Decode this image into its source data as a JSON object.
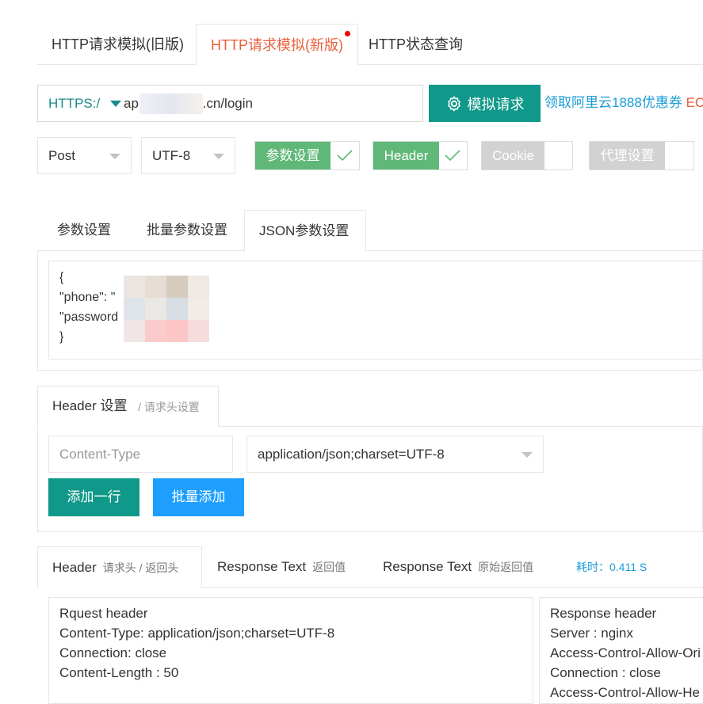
{
  "top_tabs": [
    {
      "label": "HTTP请求模拟(旧版)"
    },
    {
      "label": "HTTP请求模拟(新版)"
    },
    {
      "label": "HTTP状态查询"
    }
  ],
  "url_bar": {
    "protocol": "HTTPS:/",
    "url_prefix": "ap",
    "url_suffix": "..cn/login",
    "submit_label": "模拟请求",
    "promo_text": "领取阿里云1888优惠券",
    "promo_tail": "EC"
  },
  "options": {
    "method": "Post",
    "charset": "UTF-8",
    "switches": [
      {
        "label": "参数设置",
        "on": true
      },
      {
        "label": "Header",
        "on": true
      },
      {
        "label": "Cookie",
        "on": false
      },
      {
        "label": "代理设置",
        "on": false
      }
    ]
  },
  "param_tabs": [
    {
      "label": "参数设置"
    },
    {
      "label": "批量参数设置"
    },
    {
      "label": "JSON参数设置"
    }
  ],
  "json_body": {
    "lines": [
      "{",
      "\"phone\": \"",
      "\"password",
      "}"
    ]
  },
  "header_settings": {
    "tab_title": "Header 设置",
    "tab_subtitle": "/ 请求头设置",
    "key_placeholder": "Content-Type",
    "value": "application/json;charset=UTF-8",
    "add_row_label": "添加一行",
    "batch_add_label": "批量添加"
  },
  "response_tabs": [
    {
      "label": "Header",
      "sub": "请求头 / 返回头"
    },
    {
      "label": "Response Text",
      "sub": "返回值"
    },
    {
      "label": "Response Text",
      "sub": "原始返回值"
    }
  ],
  "elapsed": "耗时：0.411 S",
  "request_header": {
    "lines": [
      "Rquest header",
      "Content-Type: application/json;charset=UTF-8",
      "Connection: close",
      "Content-Length : 50"
    ]
  },
  "response_header": {
    "lines": [
      "Response header",
      "Server : nginx",
      "Access-Control-Allow-Ori",
      "Connection : close",
      "Access-Control-Allow-He"
    ]
  },
  "colors": {
    "accent_teal": "#10998a",
    "switch_on": "#5fb878",
    "switch_off": "#d2d2d2",
    "blue": "#1e9fff",
    "active_tab": "#e8603c"
  }
}
